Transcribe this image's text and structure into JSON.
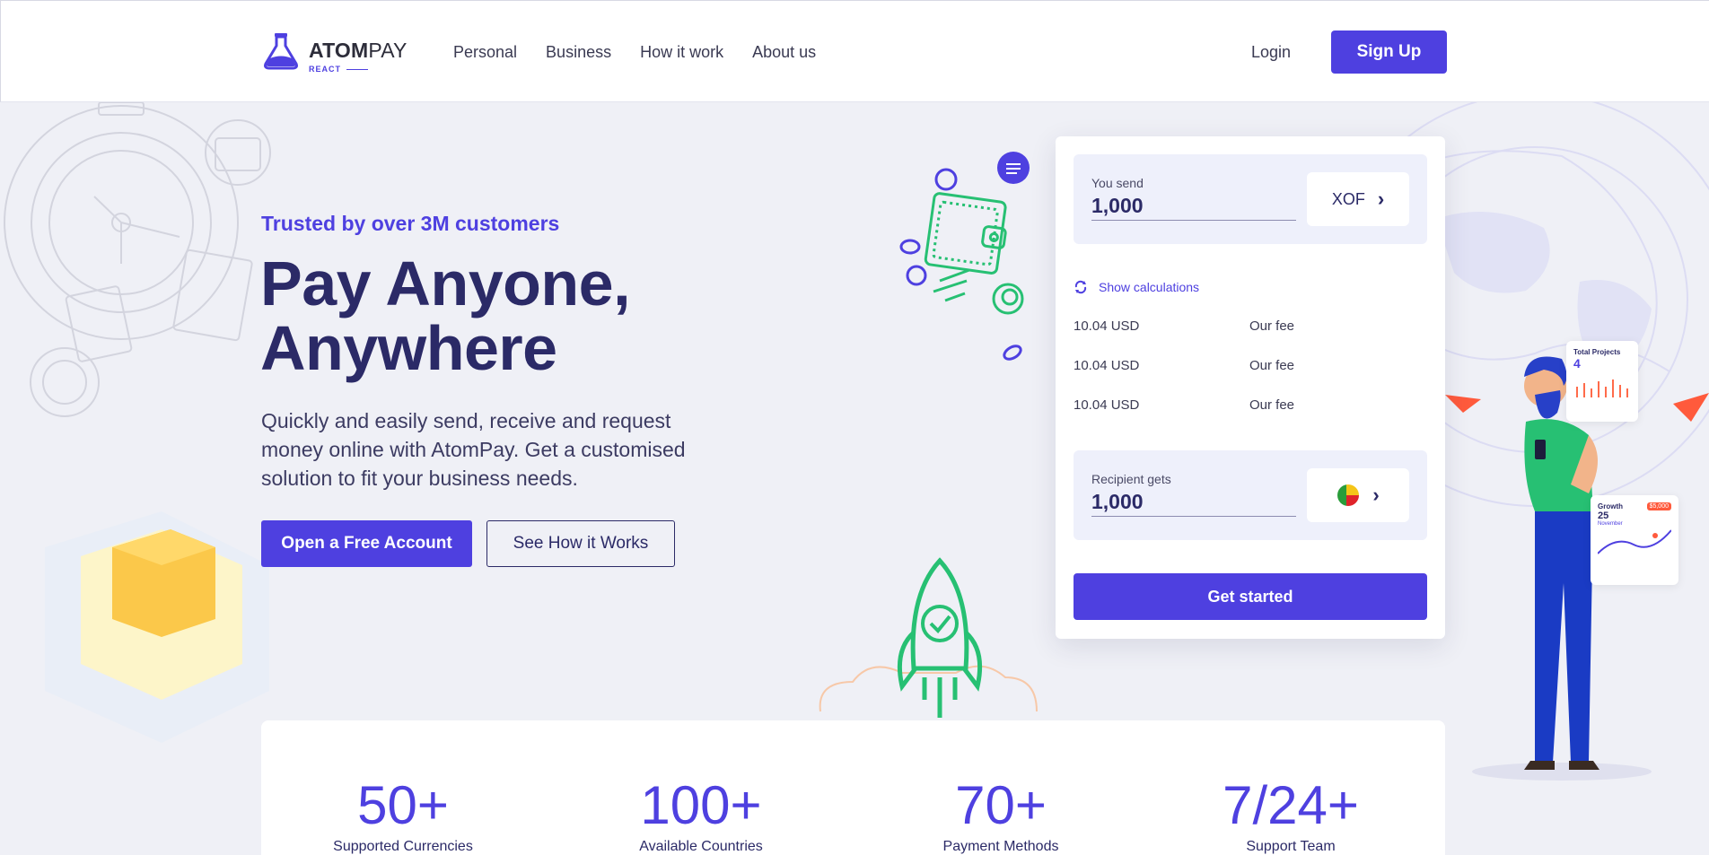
{
  "brand": {
    "name_bold": "ATOM",
    "name_light": "PAY",
    "sub": "REACT",
    "accent": "#4e40e0",
    "navy": "#2b2a67"
  },
  "nav": {
    "items": [
      "Personal",
      "Business",
      "How it work",
      "About us"
    ],
    "login": "Login",
    "signup": "Sign Up"
  },
  "hero": {
    "tagline": "Trusted by over 3M customers",
    "headline_1": "Pay Anyone,",
    "headline_2": "Anywhere",
    "description": "Quickly and easily send, receive and request money online with AtomPay. Get a customised solution to fit your business needs.",
    "primary_button": "Open a Free Account",
    "secondary_button": "See How it Works"
  },
  "converter": {
    "send_label": "You send",
    "send_value": "1,000",
    "send_currency": "XOF",
    "show_calculations": "Show calculations",
    "fees": [
      {
        "amount": "10.04 USD",
        "label": "Our fee"
      },
      {
        "amount": "10.04 USD",
        "label": "Our fee"
      },
      {
        "amount": "10.04 USD",
        "label": "Our fee"
      }
    ],
    "receive_label": "Recipient gets",
    "receive_value": "1,000",
    "receive_currency_icon": "benin-flag-icon",
    "get_started": "Get started"
  },
  "illustration": {
    "total_projects_label": "Total Projects",
    "total_projects_value": "4",
    "growth_label": "Growth",
    "growth_badge": "$5,000",
    "growth_value": "25",
    "growth_month": "November"
  },
  "stats": [
    {
      "number": "50+",
      "caption": "Supported Currencies"
    },
    {
      "number": "100+",
      "caption": "Available Countries"
    },
    {
      "number": "70+",
      "caption": "Payment Methods"
    },
    {
      "number": "7/24+",
      "caption": "Support Team"
    }
  ]
}
